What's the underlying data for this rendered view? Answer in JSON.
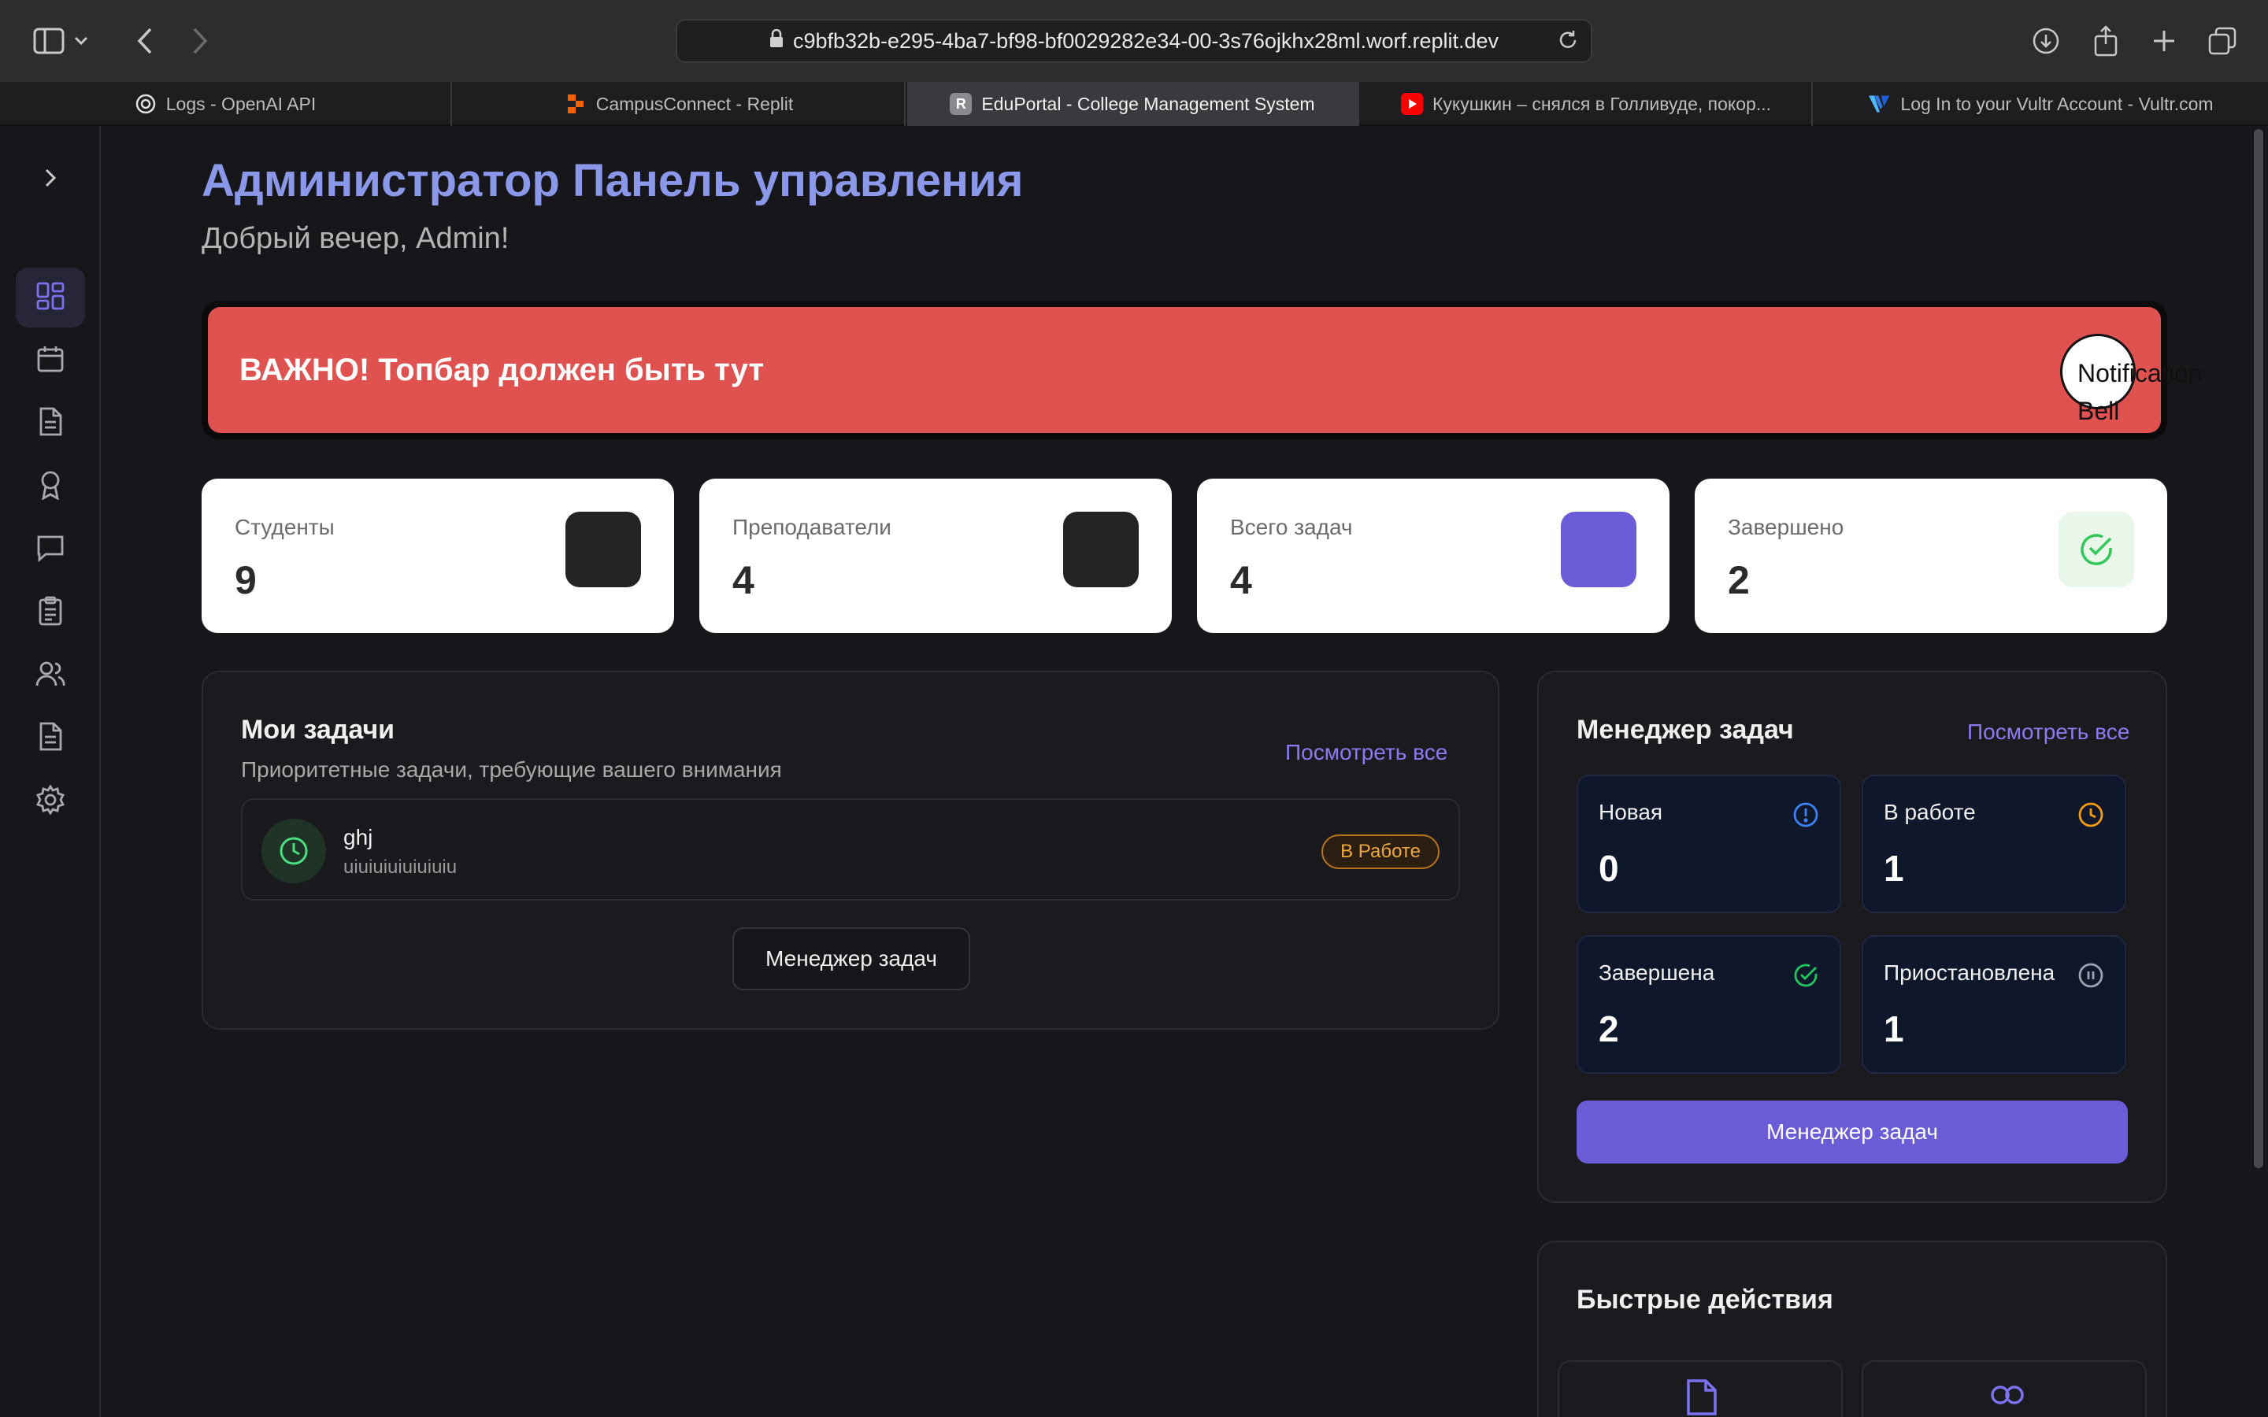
{
  "browser": {
    "url": "c9bfb32b-e295-4ba7-bf98-bf0029282e34-00-3s76ojkhx28ml.worf.replit.dev",
    "tabs": [
      {
        "label": "Logs - OpenAI API",
        "icon": "openai-icon"
      },
      {
        "label": "CampusConnect - Replit",
        "icon": "replit-icon"
      },
      {
        "label": "EduPortal - College Management System",
        "icon": "eduportal-icon",
        "favicon_letter": "R"
      },
      {
        "label": "Кукушкин – снялся в Голливуде, покор...",
        "icon": "youtube-icon"
      },
      {
        "label": "Log In to your Vultr Account - Vultr.com",
        "icon": "vultr-icon"
      }
    ],
    "active_tab": 2
  },
  "sidebar": {
    "items": [
      {
        "icon": "dashboard-icon",
        "active": true
      },
      {
        "icon": "calendar-icon"
      },
      {
        "icon": "document-icon"
      },
      {
        "icon": "award-icon"
      },
      {
        "icon": "chat-icon"
      },
      {
        "icon": "clipboard-icon"
      },
      {
        "icon": "users-icon"
      },
      {
        "icon": "report-icon"
      },
      {
        "icon": "gear-icon"
      }
    ]
  },
  "header": {
    "title": "Администратор Панель управления",
    "greeting": "Добрый вечер, Admin!"
  },
  "alert": {
    "text": "ВАЖНО! Топбар должен быть тут",
    "bell_label": "Notification Bell",
    "color": "#df524f"
  },
  "stats": [
    {
      "label": "Студенты",
      "value": "9"
    },
    {
      "label": "Преподаватели",
      "value": "4"
    },
    {
      "label": "Всего задач",
      "value": "4"
    },
    {
      "label": "Завершено",
      "value": "2"
    }
  ],
  "my_tasks": {
    "title": "Мои задачи",
    "subtitle": "Приоритетные задачи, требующие вашего внимания",
    "view_all": "Посмотреть все",
    "items": [
      {
        "name": "ghj",
        "description": "uiuiuiuiuiuiuiu",
        "status": "В Работе"
      }
    ],
    "button": "Менеджер задач"
  },
  "task_manager": {
    "title": "Менеджер задач",
    "view_all": "Посмотреть все",
    "cards": [
      {
        "label": "Новая",
        "value": "0",
        "icon": "info-icon",
        "color": "#3b82f6"
      },
      {
        "label": "В работе",
        "value": "1",
        "icon": "clock-icon",
        "color": "#f59e0b"
      },
      {
        "label": "Завершена",
        "value": "2",
        "icon": "check-circle-icon",
        "color": "#22c55e"
      },
      {
        "label": "Приостановлена",
        "value": "1",
        "icon": "pause-icon",
        "color": "#9ca3af"
      }
    ],
    "button": "Менеджер задач"
  },
  "quick_actions": {
    "title": "Быстрые действия"
  },
  "colors": {
    "accent": "#6a5bd6",
    "title": "#8b97e8"
  }
}
